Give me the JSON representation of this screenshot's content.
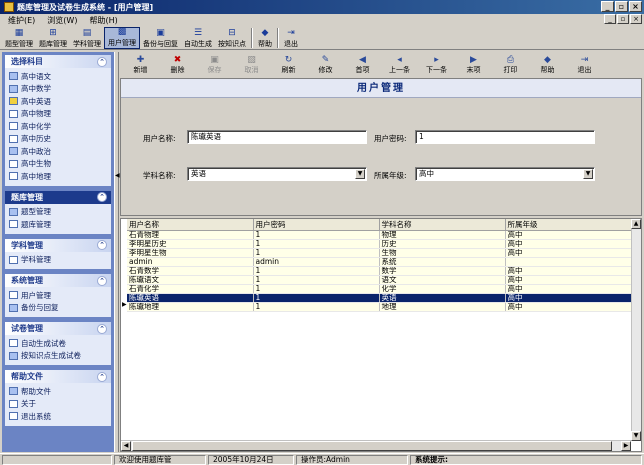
{
  "window": {
    "title": "题库管理及试卷生成系统 - [用户管理]",
    "min": "_",
    "max": "▫",
    "close": "×"
  },
  "menu": [
    {
      "label": "维护(E)"
    },
    {
      "label": "浏览(W)"
    },
    {
      "label": "帮助(H)"
    }
  ],
  "toolbar": [
    {
      "label": "题型管理",
      "icon": "▦"
    },
    {
      "label": "题库管理",
      "icon": "⊞"
    },
    {
      "label": "学科管理",
      "icon": "▤"
    },
    {
      "label": "用户管理",
      "icon": "▩",
      "active": true
    },
    {
      "label": "备份与回复",
      "icon": "▣"
    },
    {
      "label": "自动生成",
      "icon": "☰"
    },
    {
      "label": "按知识点",
      "icon": "⊟"
    },
    {
      "label": "帮助",
      "icon": "◆"
    },
    {
      "label": "退出",
      "icon": "⇥"
    }
  ],
  "sidebar": {
    "groups": [
      {
        "title": "选择科目",
        "items": [
          "高中语文",
          "高中数学",
          "高中英语",
          "高中物理",
          "高中化学",
          "高中历史",
          "高中政治",
          "高中生物",
          "高中地理"
        ]
      },
      {
        "title": "题库管理",
        "items": [
          "题型管理",
          "题库管理"
        ],
        "active": true
      },
      {
        "title": "学科管理",
        "items": [
          "学科管理"
        ]
      },
      {
        "title": "系统管理",
        "items": [
          "用户管理",
          "备份与回复"
        ]
      },
      {
        "title": "试卷管理",
        "items": [
          "自动生成试卷",
          "按知识点生成试卷"
        ]
      },
      {
        "title": "帮助文件",
        "items": [
          "帮助文件",
          "关于",
          "退出系统"
        ]
      }
    ],
    "collapse_icon": "⌃"
  },
  "subtoolbar": [
    {
      "label": "新增",
      "icon": "✚",
      "enabled": true
    },
    {
      "label": "删除",
      "icon": "✖",
      "enabled": true
    },
    {
      "label": "保存",
      "icon": "▣",
      "enabled": false
    },
    {
      "label": "取消",
      "icon": "▧",
      "enabled": false
    },
    {
      "label": "刷新",
      "icon": "↻",
      "enabled": true
    },
    {
      "label": "修改",
      "icon": "✎",
      "enabled": true
    },
    {
      "label": "首项",
      "icon": "◀",
      "enabled": true
    },
    {
      "label": "上一条",
      "icon": "◂",
      "enabled": true
    },
    {
      "label": "下一条",
      "icon": "▸",
      "enabled": true
    },
    {
      "label": "末项",
      "icon": "▶",
      "enabled": true
    },
    {
      "label": "打印",
      "icon": "⎙",
      "enabled": true
    },
    {
      "label": "帮助",
      "icon": "◆",
      "enabled": true
    },
    {
      "label": "退出",
      "icon": "⇥",
      "enabled": true
    }
  ],
  "form": {
    "title": "用户管理",
    "username_label": "用户名称:",
    "username_value": "陈瓛英语",
    "password_label": "用户密码:",
    "password_value": "1",
    "subject_label": "学科名称:",
    "subject_value": "英语",
    "grade_label": "所属年级:",
    "grade_value": "高中",
    "dropdown_icon": "▼"
  },
  "grid": {
    "columns": [
      "用户名称",
      "用户密码",
      "学科名称",
      "所属年级"
    ],
    "rows": [
      [
        "石青物理",
        "1",
        "物理",
        "高中"
      ],
      [
        "李明星历史",
        "1",
        "历史",
        "高中"
      ],
      [
        "李明星生物",
        "1",
        "生物",
        "高中"
      ],
      [
        "admin",
        "admin",
        "系统",
        ""
      ],
      [
        "石青数学",
        "1",
        "数学",
        "高中"
      ],
      [
        "陈瓛语文",
        "1",
        "语文",
        "高中"
      ],
      [
        "石青化学",
        "1",
        "化学",
        "高中"
      ],
      [
        "陈瓛英语",
        "1",
        "英语",
        "高中"
      ],
      [
        "陈瓛地理",
        "1",
        "地理",
        "高中"
      ]
    ],
    "selected_index": 7,
    "row_indicator": "▶",
    "scroll_up": "▲",
    "scroll_down": "▼",
    "scroll_left": "◀",
    "scroll_right": "▶"
  },
  "status": {
    "welcome": "欢迎使用题库管",
    "date": "2005年10月24日",
    "operator": "操作员:Admin",
    "hint": "系统提示:"
  }
}
